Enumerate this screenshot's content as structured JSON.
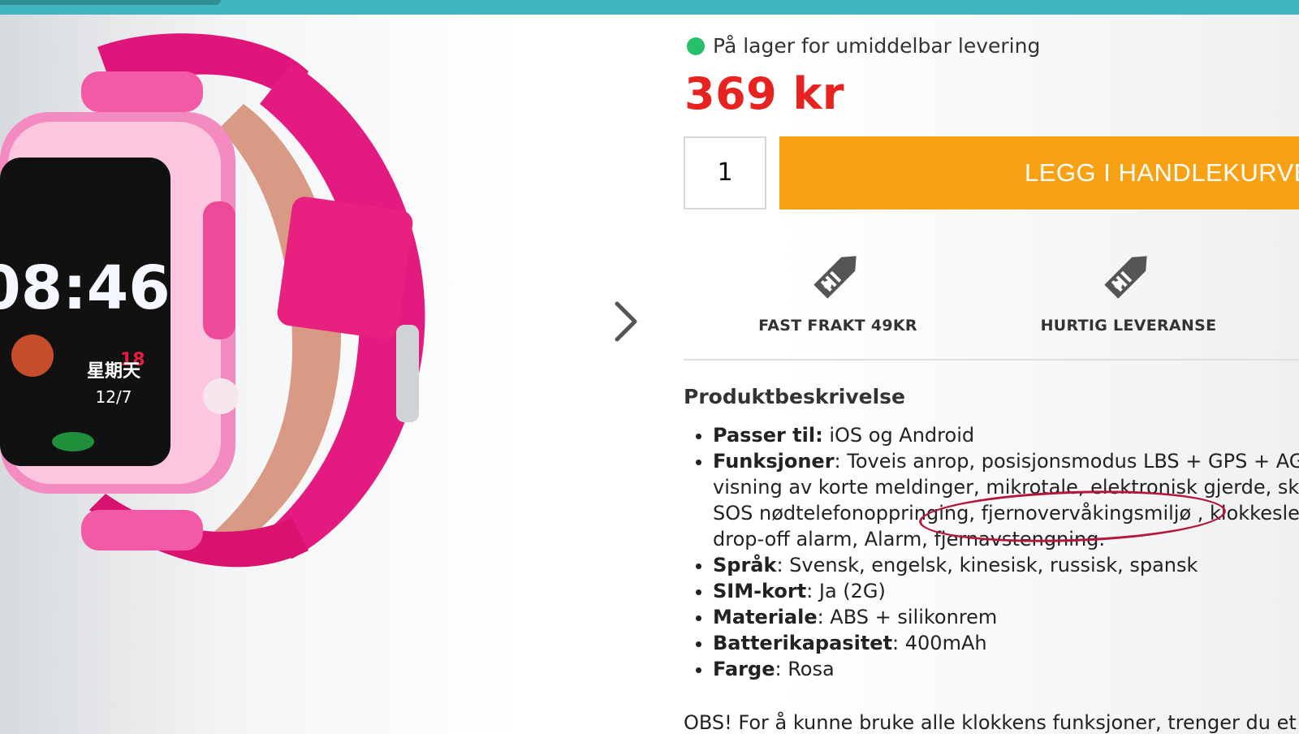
{
  "stock": {
    "text": "På lager for umiddelbar levering",
    "color": "#27c06a"
  },
  "price": "369 kr",
  "cart": {
    "quantity": "1",
    "button_label": "LEGG I HANDLEKURVEN"
  },
  "features": [
    {
      "icon": "price-tag-icon",
      "label": "FAST FRAKT 49KR"
    },
    {
      "icon": "price-tag-icon",
      "label": "HURTIG LEVERANSE"
    }
  ],
  "product_image": {
    "screen_time": "08:46",
    "screen_day": "星期天",
    "screen_date": "12/7",
    "screen_heart": "18"
  },
  "description": {
    "title": "Produktbeskrivelse",
    "items": [
      {
        "key": "Passer til:",
        "value": " iOS og Android"
      },
      {
        "key": "Funksjoner",
        "value": ": Toveis anrop, posisjonsmodus LBS + GPS + AGPS",
        "lines": [
          "visning av korte meldinger, mikrotale, elektronisk gjerde, skr",
          "SOS nødtelefonoppringing, fjernovervåkingsmiljø , klokkeslet",
          "drop-off alarm, Alarm, fjernavstengning."
        ]
      },
      {
        "key": "Språk",
        "value": ": Svensk, engelsk, kinesisk, russisk, spansk"
      },
      {
        "key": "SIM-kort",
        "value": ": Ja (2G)"
      },
      {
        "key": "Materiale",
        "value": ": ABS + silikonrem"
      },
      {
        "key": "Batterikapasitet",
        "value": ": 400mAh"
      },
      {
        "key": "Farge",
        "value": ": Rosa"
      }
    ],
    "note": "OBS! For å kunne bruke alle klokkens funksjoner, trenger du et S"
  },
  "colors": {
    "accent_orange": "#f7a113",
    "price_red": "#e8231f",
    "topbar": "#3fb6bd",
    "annotation": "#b5173c"
  }
}
